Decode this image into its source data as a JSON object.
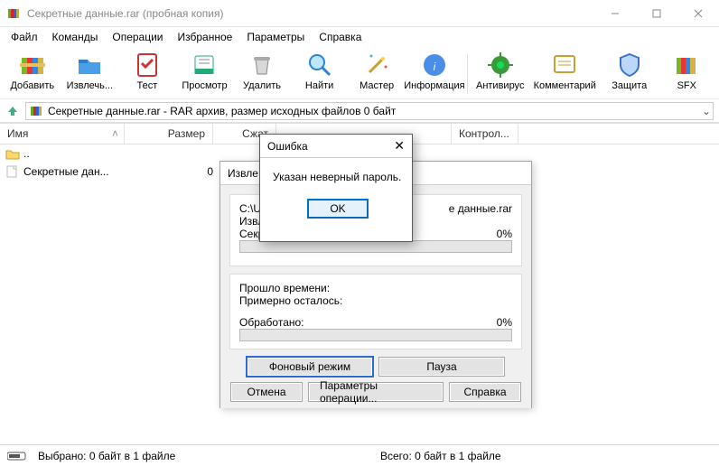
{
  "window": {
    "title": "Секретные данные.rar (пробная копия)"
  },
  "menu": {
    "file": "Файл",
    "commands": "Команды",
    "operations": "Операции",
    "favorites": "Избранное",
    "parameters": "Параметры",
    "help": "Справка"
  },
  "toolbar": {
    "add": "Добавить",
    "extract": "Извлечь...",
    "test": "Тест",
    "view": "Просмотр",
    "delete": "Удалить",
    "find": "Найти",
    "wizard": "Мастер",
    "info": "Информация",
    "antivirus": "Антивирус",
    "comment": "Комментарий",
    "protect": "Защита",
    "sfx": "SFX"
  },
  "path": "Секретные данные.rar - RAR архив, размер исходных файлов 0 байт",
  "columns": {
    "name": "Имя",
    "size": "Размер",
    "packed": "Сжат",
    "crc": "Контрол..."
  },
  "rows": {
    "up": "..",
    "file": {
      "name": "Секретные дан...",
      "size": "0"
    }
  },
  "status": {
    "left": "Выбрано: 0 байт в 1 файле",
    "right": "Всего: 0 байт в 1 файле"
  },
  "progress_dialog": {
    "title": "Извле",
    "line1": "C:\\U",
    "line_file_suffix": "е данные.rar",
    "line2": "Извл",
    "line3": "Секр",
    "pct1": "0%",
    "elapsed": "Прошло времени:",
    "remaining": "Примерно осталось:",
    "processed": "Обработано:",
    "pct2": "0%",
    "bg": "Фоновый режим",
    "pause": "Пауза",
    "cancel": "Отмена",
    "params": "Параметры операции...",
    "help": "Справка"
  },
  "error_dialog": {
    "title": "Ошибка",
    "message": "Указан неверный пароль.",
    "ok": "OK"
  }
}
